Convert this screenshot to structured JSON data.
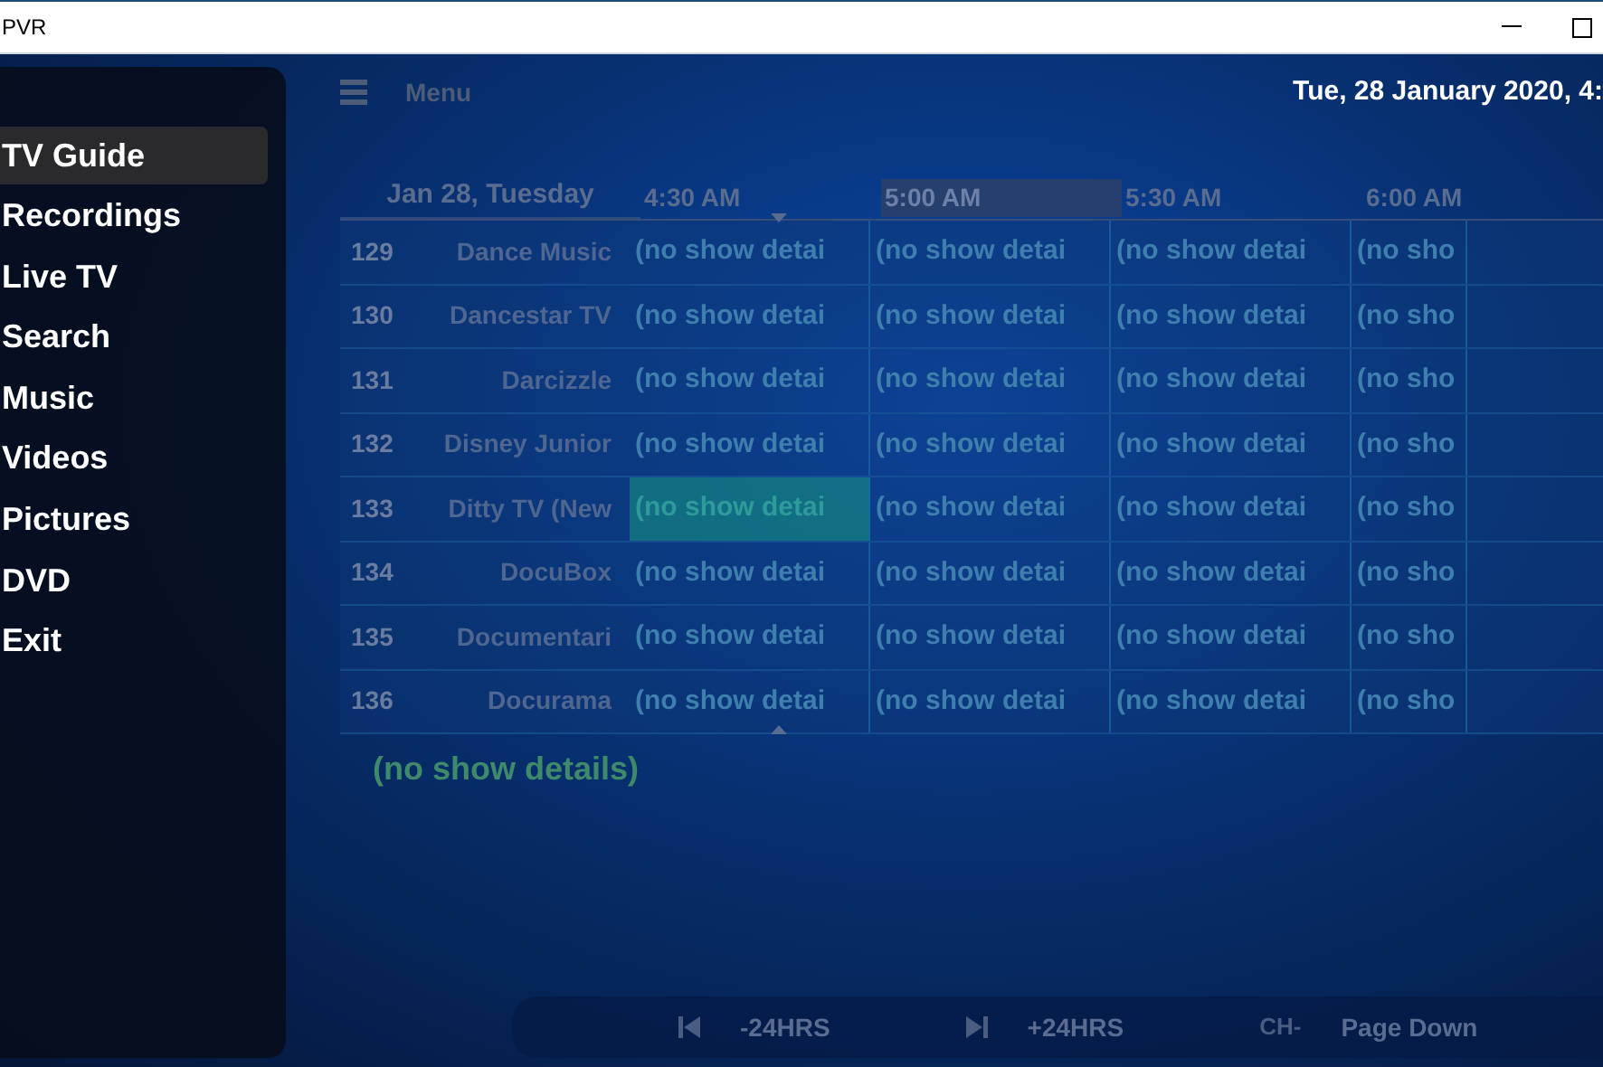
{
  "window": {
    "title": "PVR"
  },
  "menu": [
    {
      "label": "TV Guide",
      "selected": true
    },
    {
      "label": "Recordings",
      "selected": false
    },
    {
      "label": "Live TV",
      "selected": false
    },
    {
      "label": "Search",
      "selected": false
    },
    {
      "label": "Music",
      "selected": false
    },
    {
      "label": "Videos",
      "selected": false
    },
    {
      "label": "Pictures",
      "selected": false
    },
    {
      "label": "DVD",
      "selected": false
    },
    {
      "label": "Exit",
      "selected": false
    }
  ],
  "header": {
    "menu_label": "Menu",
    "datetime": "Tue, 28 January 2020, 4:"
  },
  "timeline": {
    "date": "Jan 28, Tuesday",
    "times": [
      {
        "label": "4:30 AM",
        "selected": false
      },
      {
        "label": "5:00 AM",
        "selected": true
      },
      {
        "label": "5:30 AM",
        "selected": false
      },
      {
        "label": "6:00 AM",
        "selected": false
      }
    ]
  },
  "channels": [
    {
      "number": "129",
      "name": "Dance Music",
      "programs": [
        {
          "title": "(no show detai",
          "selected": false
        },
        {
          "title": "(no show detai",
          "selected": false
        },
        {
          "title": "(no show detai",
          "selected": false
        },
        {
          "title": "(no sho",
          "selected": false
        }
      ]
    },
    {
      "number": "130",
      "name": "Dancestar TV",
      "programs": [
        {
          "title": "(no show detai",
          "selected": false
        },
        {
          "title": "(no show detai",
          "selected": false
        },
        {
          "title": "(no show detai",
          "selected": false
        },
        {
          "title": "(no sho",
          "selected": false
        }
      ]
    },
    {
      "number": "131",
      "name": "Darcizzle",
      "programs": [
        {
          "title": "(no show detai",
          "selected": false
        },
        {
          "title": "(no show detai",
          "selected": false
        },
        {
          "title": "(no show detai",
          "selected": false
        },
        {
          "title": "(no sho",
          "selected": false
        }
      ]
    },
    {
      "number": "132",
      "name": "Disney Junior",
      "programs": [
        {
          "title": "(no show detai",
          "selected": false
        },
        {
          "title": "(no show detai",
          "selected": false
        },
        {
          "title": "(no show detai",
          "selected": false
        },
        {
          "title": "(no sho",
          "selected": false
        }
      ]
    },
    {
      "number": "133",
      "name": "Ditty TV (New",
      "programs": [
        {
          "title": "(no show detai",
          "selected": true
        },
        {
          "title": "(no show detai",
          "selected": false
        },
        {
          "title": "(no show detai",
          "selected": false
        },
        {
          "title": "(no sho",
          "selected": false
        }
      ]
    },
    {
      "number": "134",
      "name": "DocuBox",
      "programs": [
        {
          "title": "(no show detai",
          "selected": false
        },
        {
          "title": "(no show detai",
          "selected": false
        },
        {
          "title": "(no show detai",
          "selected": false
        },
        {
          "title": "(no sho",
          "selected": false
        }
      ]
    },
    {
      "number": "135",
      "name": "Documentari",
      "programs": [
        {
          "title": "(no show detai",
          "selected": false
        },
        {
          "title": "(no show detai",
          "selected": false
        },
        {
          "title": "(no show detai",
          "selected": false
        },
        {
          "title": "(no sho",
          "selected": false
        }
      ]
    },
    {
      "number": "136",
      "name": "Docurama",
      "programs": [
        {
          "title": "(no show detai",
          "selected": false
        },
        {
          "title": "(no show detai",
          "selected": false
        },
        {
          "title": "(no show detai",
          "selected": false
        },
        {
          "title": "(no sho",
          "selected": false
        }
      ]
    }
  ],
  "details": "(no show details)",
  "footer": [
    {
      "kind": "skip_back",
      "label": "-24HRS"
    },
    {
      "kind": "skip_forward",
      "label": "+24HRS"
    },
    {
      "kind": "key",
      "key": "CH-",
      "label": "Page Down"
    }
  ]
}
